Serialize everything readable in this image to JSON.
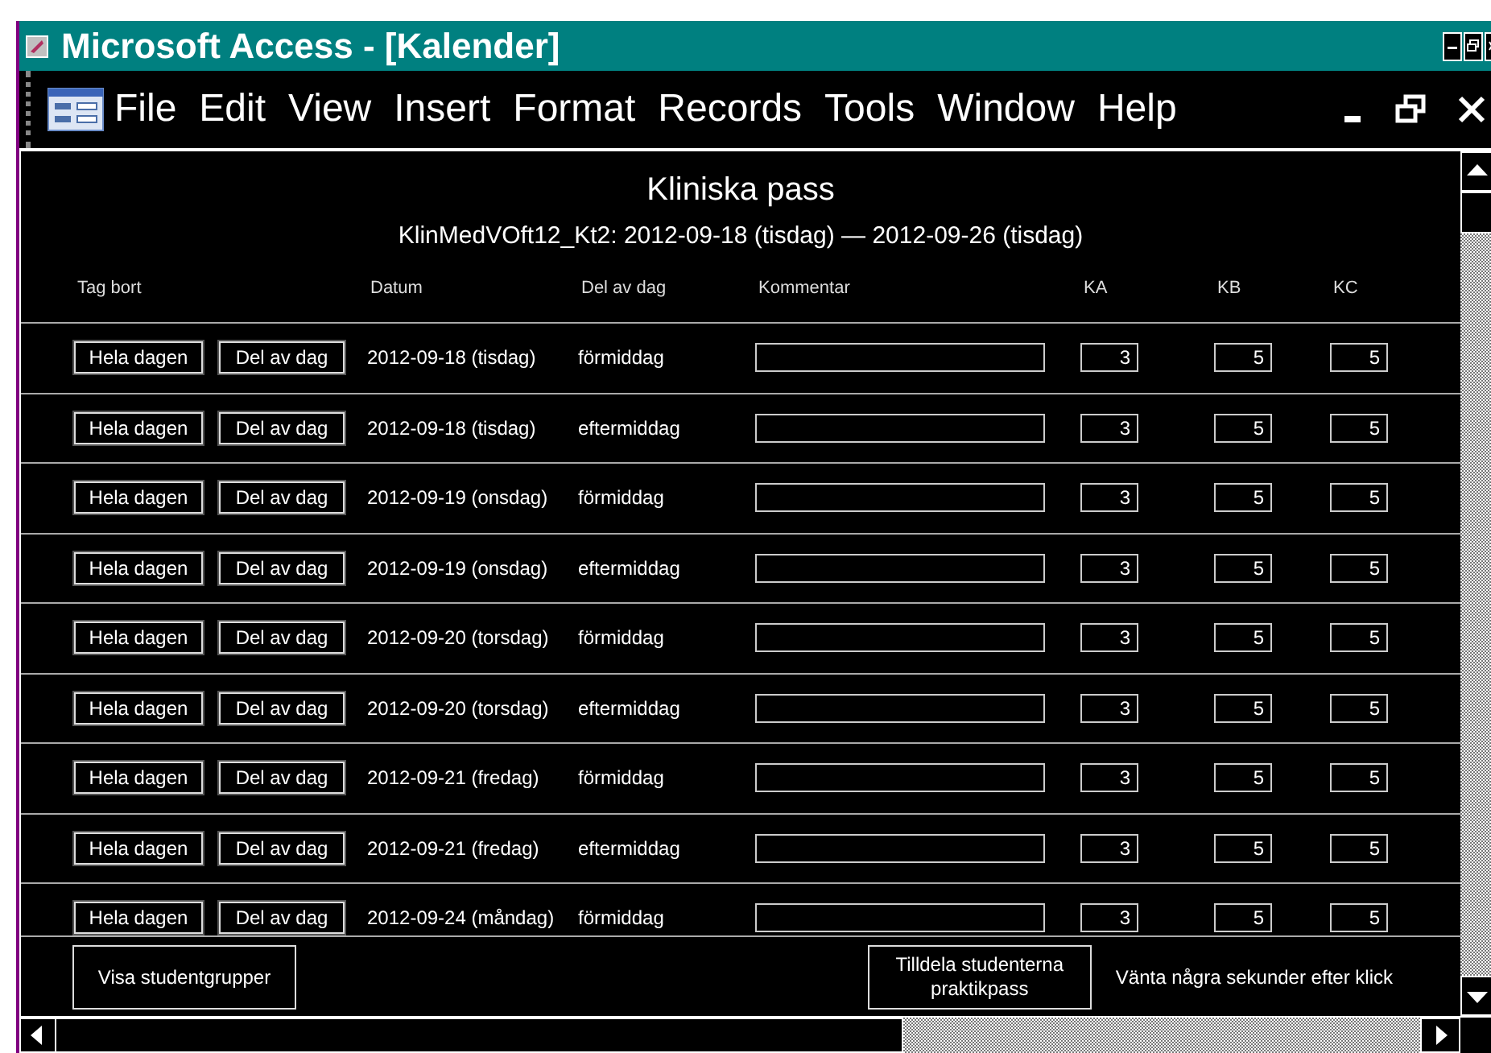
{
  "window": {
    "title": "Microsoft Access - [Kalender]"
  },
  "menu": [
    "File",
    "Edit",
    "View",
    "Insert",
    "Format",
    "Records",
    "Tools",
    "Window",
    "Help"
  ],
  "form": {
    "title": "Kliniska pass",
    "subtitle": "KlinMedVOft12_Kt2: 2012-09-18 (tisdag) — 2012-09-26 (tisdag)",
    "columns": [
      "Tag bort",
      "Datum",
      "Del av dag",
      "Kommentar",
      "KA",
      "KB",
      "KC"
    ],
    "rows": [
      {
        "delete_all": "Hela dagen",
        "delete_part": "Del av dag",
        "date": "2012-09-18 (tisdag)",
        "part": "förmiddag",
        "ka": "3",
        "kb": "5",
        "kc": "5"
      },
      {
        "delete_all": "Hela dagen",
        "delete_part": "Del av dag",
        "date": "2012-09-18 (tisdag)",
        "part": "eftermiddag",
        "ka": "3",
        "kb": "5",
        "kc": "5"
      },
      {
        "delete_all": "Hela dagen",
        "delete_part": "Del av dag",
        "date": "2012-09-19 (onsdag)",
        "part": "förmiddag",
        "ka": "3",
        "kb": "5",
        "kc": "5"
      },
      {
        "delete_all": "Hela dagen",
        "delete_part": "Del av dag",
        "date": "2012-09-19 (onsdag)",
        "part": "eftermiddag",
        "ka": "3",
        "kb": "5",
        "kc": "5"
      },
      {
        "delete_all": "Hela dagen",
        "delete_part": "Del av dag",
        "date": "2012-09-20 (torsdag)",
        "part": "förmiddag",
        "ka": "3",
        "kb": "5",
        "kc": "5"
      },
      {
        "delete_all": "Hela dagen",
        "delete_part": "Del av dag",
        "date": "2012-09-20 (torsdag)",
        "part": "eftermiddag",
        "ka": "3",
        "kb": "5",
        "kc": "5"
      },
      {
        "delete_all": "Hela dagen",
        "delete_part": "Del av dag",
        "date": "2012-09-21 (fredag)",
        "part": "förmiddag",
        "ka": "3",
        "kb": "5",
        "kc": "5"
      },
      {
        "delete_all": "Hela dagen",
        "delete_part": "Del av dag",
        "date": "2012-09-21 (fredag)",
        "part": "eftermiddag",
        "ka": "3",
        "kb": "5",
        "kc": "5"
      },
      {
        "delete_all": "Hela dagen",
        "delete_part": "Del av dag",
        "date": "2012-09-24 (måndag)",
        "part": "förmiddag",
        "ka": "3",
        "kb": "5",
        "kc": "5"
      }
    ],
    "footer": {
      "groups_button": "Visa studentgrupper",
      "assign_button": "Tilldela studenterna praktikpass",
      "note": "Vänta några sekunder efter klick"
    }
  }
}
